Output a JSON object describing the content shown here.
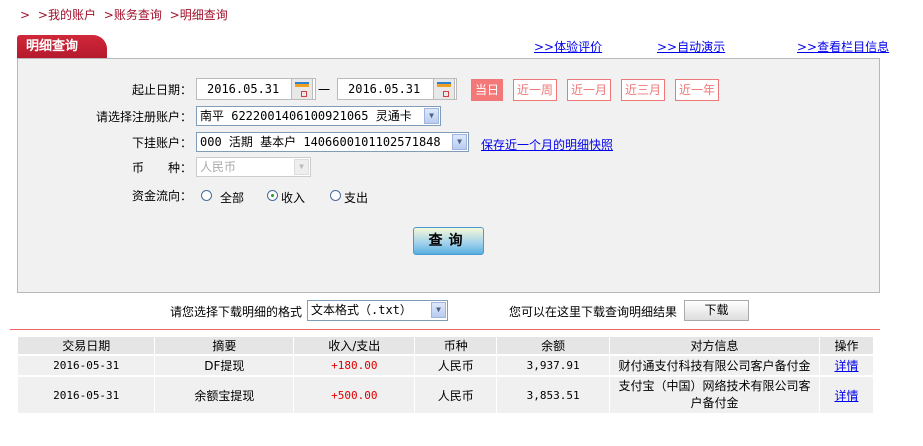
{
  "breadcrumb": [
    ">",
    ">我的账户",
    ">账务查询",
    ">明细查询"
  ],
  "tab_title": "明细查询",
  "top_links": [
    ">>体验评价",
    ">>自动演示",
    ">>查看栏目信息"
  ],
  "form": {
    "date_label": "起止日期：",
    "date_start": "2016.05.31",
    "date_sep": "一",
    "date_end": "2016.05.31",
    "quick_ranges": [
      "当日",
      "近一周",
      "近一月",
      "近三月",
      "近一年"
    ],
    "active_range": "当日",
    "account_label": "请选择注册账户：",
    "account_value": "南平 6222001406100921065 灵通卡",
    "sub_account_label": "下挂账户：",
    "sub_account_value": "000 活期 基本户 1406600101102571848",
    "snapshot_link": "保存近一个月的明细快照",
    "currency_label": "币　　种：",
    "currency_value": "人民币",
    "flow_label": "资金流向：",
    "flow_options": [
      "全部",
      "收入",
      "支出"
    ],
    "flow_selected": "收入",
    "query_button": "查询"
  },
  "download": {
    "format_label": "请您选择下载明细的格式",
    "format_value": "文本格式（.txt）",
    "hint": "您可以在这里下载查询明细结果",
    "button": "下载"
  },
  "table": {
    "headers": [
      "交易日期",
      "摘要",
      "收入/支出",
      "币种",
      "余额",
      "对方信息",
      "操作"
    ],
    "rows": [
      [
        "2016-05-31",
        "DF提现",
        "+180.00",
        "人民币",
        "3,937.91",
        "财付通支付科技有限公司客户备付金",
        "详情"
      ],
      [
        "2016-05-31",
        "余额宝提现",
        "+500.00",
        "人民币",
        "3,853.51",
        "支付宝（中国）网络技术有限公司客户备付金",
        "详情"
      ]
    ]
  },
  "colors": {
    "brand_red": "#b51a2c",
    "quick_range": "#f07878",
    "link": "#0000ee",
    "amount": "#dd0000"
  }
}
